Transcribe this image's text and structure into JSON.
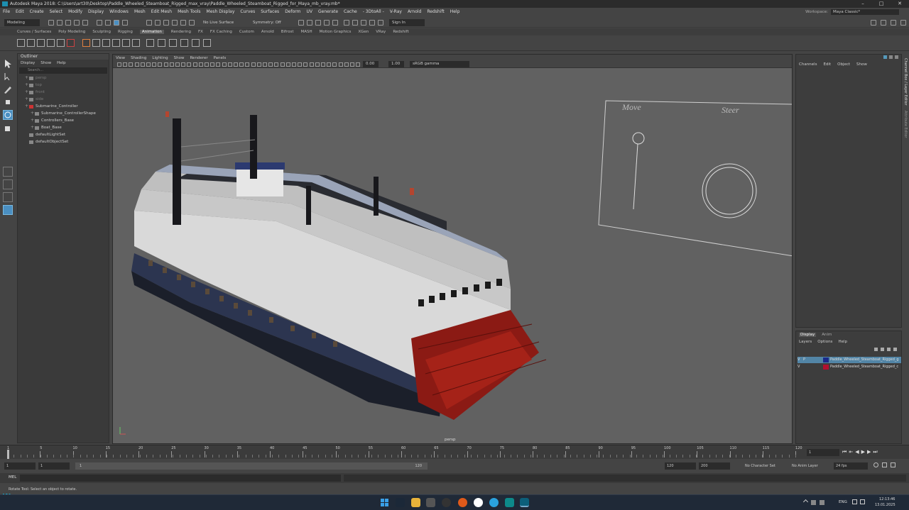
{
  "window": {
    "title": "Autodesk Maya 2018: C:\\Users\\art30\\Desktop\\Paddle_Wheeled_Steamboat_Rigged_max_vray\\Paddle_Wheeled_Steamboat_Rigged_for_Maya_mb_vray.mb*"
  },
  "menu": [
    "File",
    "Edit",
    "Create",
    "Select",
    "Modify",
    "Display",
    "Windows",
    "Mesh",
    "Edit Mesh",
    "Mesh Tools",
    "Mesh Display",
    "Curves",
    "Surfaces",
    "Deform",
    "UV",
    "Generate",
    "Cache",
    "- 3DtoAll -",
    "V-Ray",
    "Arnold",
    "Redshift",
    "Help"
  ],
  "workspace": {
    "label": "Workspace:",
    "value": "Maya Classic*"
  },
  "status": {
    "mode": "Modeling",
    "live": "No Live Surface",
    "symmetry": "Symmetry: Off",
    "signin": "Sign In"
  },
  "shelf_tabs": [
    "Curves / Surfaces",
    "Poly Modeling",
    "Sculpting",
    "Rigging",
    "Animation",
    "Rendering",
    "FX",
    "FX Caching",
    "Custom",
    "Arnold",
    "Bifrost",
    "MASH",
    "Motion Graphics",
    "XGen",
    "VRay",
    "Redshift"
  ],
  "shelf_active": "Animation",
  "outliner": {
    "title": "Outliner",
    "menu": [
      "Display",
      "Show",
      "Help"
    ],
    "search": "Search...",
    "items": [
      {
        "label": "persp",
        "dim": true
      },
      {
        "label": "top",
        "dim": true
      },
      {
        "label": "front",
        "dim": true
      },
      {
        "label": "side",
        "dim": true
      },
      {
        "label": "Submarine_Controller",
        "dim": false
      },
      {
        "label": "Submarine_ControllerShape",
        "dim": false
      },
      {
        "label": "Controllers_Base",
        "dim": false
      },
      {
        "label": "Boat_Base",
        "dim": false
      },
      {
        "label": "defaultLightSet",
        "dim": false
      },
      {
        "label": "defaultObjectSet",
        "dim": false
      }
    ]
  },
  "viewport": {
    "menu": [
      "View",
      "Shading",
      "Lighting",
      "Show",
      "Renderer",
      "Panels"
    ],
    "exposure": "0.00",
    "gamma": "1.00",
    "colorspace": "sRGB gamma",
    "camera": "persp",
    "controller_text_1": "Move",
    "controller_text_2": "Steer"
  },
  "channelbox": {
    "menu": [
      "Channels",
      "Edit",
      "Object",
      "Show"
    ],
    "side_tabs": [
      "Channel Box / Layer Editor",
      "Attribute Editor"
    ]
  },
  "layers": {
    "tabs": [
      "Display",
      "Anim"
    ],
    "menu": [
      "Layers",
      "Options",
      "Help"
    ],
    "rows": [
      {
        "v": "V",
        "p": "P",
        "name": "Paddle_Wheeled_Steamboat_Rigged_g",
        "color": "#1a2a8a"
      },
      {
        "v": "V",
        "p": "",
        "name": "Paddle_Wheeled_Steamboat_Rigged_c",
        "color": "#b01030"
      }
    ]
  },
  "timeline": {
    "ticks": [
      "1",
      "5",
      "10",
      "15",
      "20",
      "25",
      "30",
      "35",
      "40",
      "45",
      "50",
      "55",
      "60",
      "65",
      "70",
      "75",
      "80",
      "85",
      "90",
      "95",
      "100",
      "105",
      "110",
      "115",
      "120"
    ],
    "current": "1"
  },
  "range": {
    "start": "1",
    "inner_start": "1",
    "slider_label": "1",
    "slider_end": "120",
    "end": "120",
    "anim_end": "200",
    "char_set": "No Character Set",
    "anim_layer": "No Anim Layer",
    "fps": "24 fps"
  },
  "cmdline": {
    "label": "MEL"
  },
  "help": {
    "text": "Rotate Tool: Select an object to rotate."
  },
  "taskbar": {
    "lang": "ENG",
    "time": "12:13:46",
    "date": "13.01.2025"
  }
}
